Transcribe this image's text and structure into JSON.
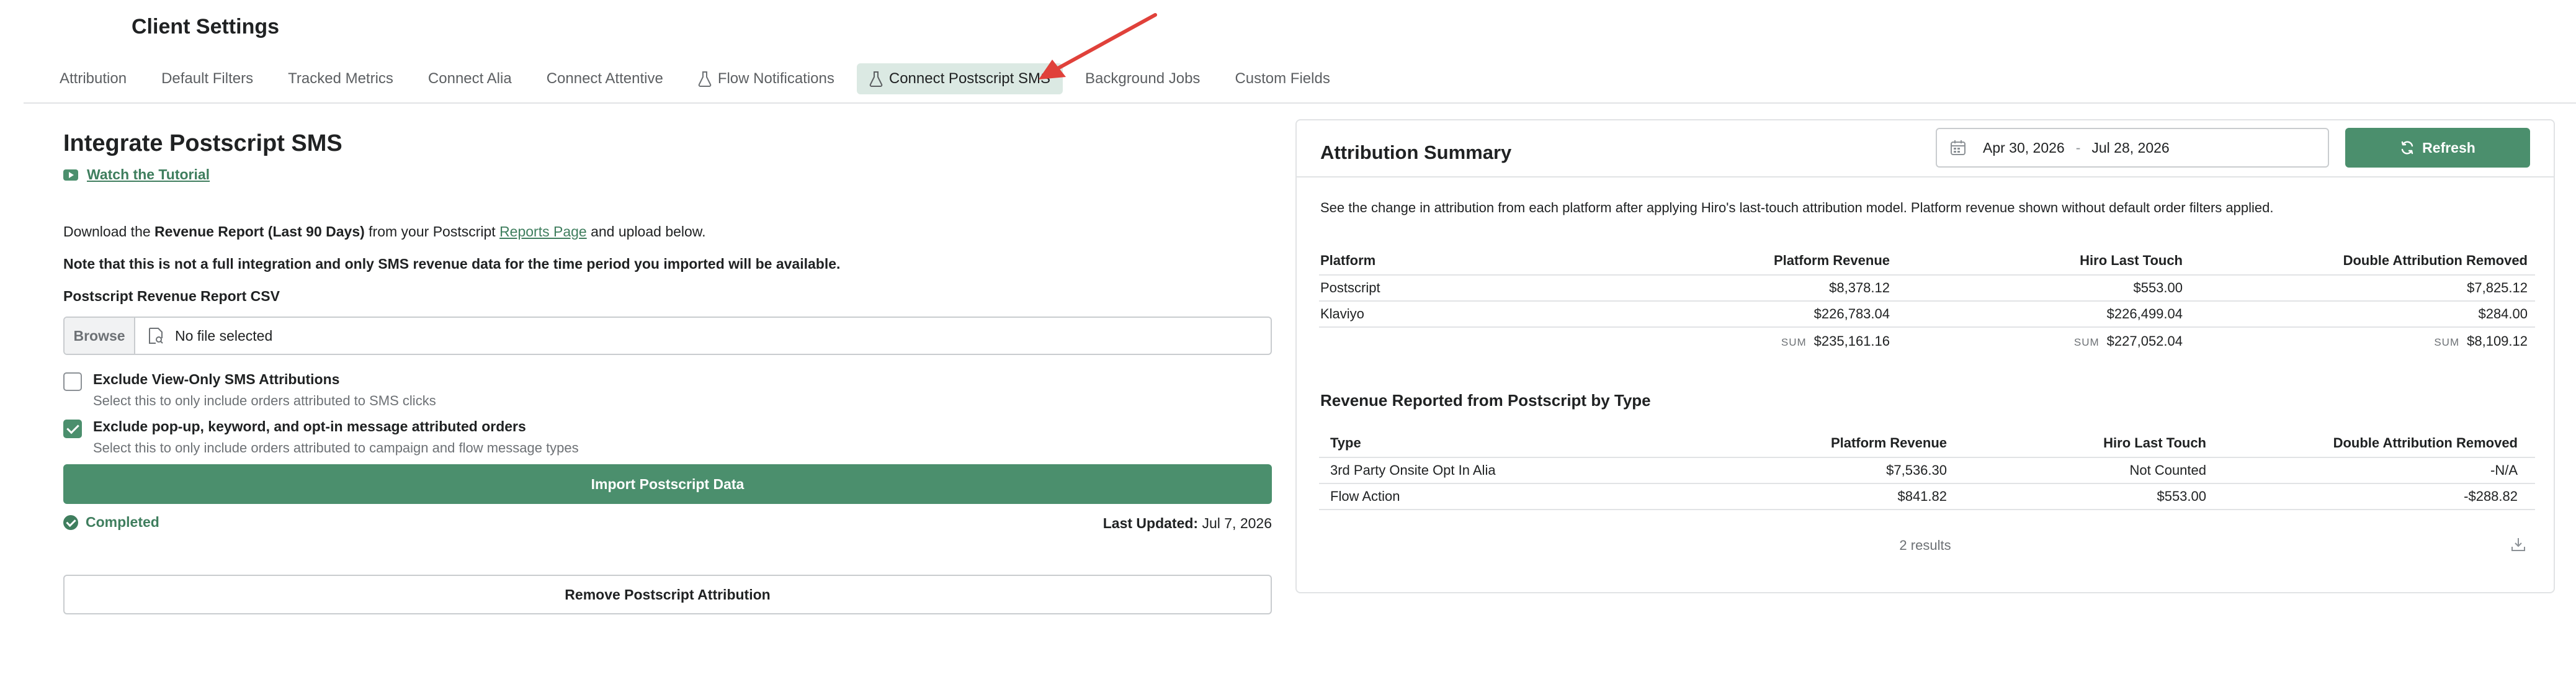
{
  "header": {
    "title": "Client Settings"
  },
  "tabs": [
    {
      "label": "Attribution"
    },
    {
      "label": "Default Filters"
    },
    {
      "label": "Tracked Metrics"
    },
    {
      "label": "Connect Alia"
    },
    {
      "label": "Connect Attentive"
    },
    {
      "label": "Flow Notifications",
      "icon": "flask-icon"
    },
    {
      "label": "Connect Postscript SMS",
      "icon": "flask-icon",
      "active": true
    },
    {
      "label": "Background Jobs"
    },
    {
      "label": "Custom Fields"
    }
  ],
  "integrate": {
    "title": "Integrate Postscript SMS",
    "tutorial_label": "Watch the Tutorial",
    "desc_prefix": "Download the ",
    "desc_report": "Revenue Report (Last 90 Days)",
    "desc_middle": " from your Postscript ",
    "desc_link": "Reports Page",
    "desc_suffix": " and upload below.",
    "note": "Note that this is not a full integration and only SMS revenue data for the time period you imported will be available.",
    "csv_label": "Postscript Revenue Report CSV",
    "browse_label": "Browse",
    "file_status": "No file selected",
    "checkbox1": {
      "title": "Exclude View-Only SMS Attributions",
      "sub": "Select this to only include orders attributed to SMS clicks",
      "checked": false
    },
    "checkbox2": {
      "title": "Exclude pop-up, keyword, and opt-in message attributed orders",
      "sub": "Select this to only include orders attributed to campaign and flow message types",
      "checked": true
    },
    "import_label": "Import Postscript Data",
    "status": "Completed",
    "last_updated_label": "Last Updated:",
    "last_updated_value": "Jul 7, 2026",
    "remove_label": "Remove Postscript Attribution"
  },
  "summary": {
    "title": "Attribution Summary",
    "date_start": "Apr 30, 2026",
    "date_sep": "-",
    "date_end": "Jul 28, 2026",
    "refresh_label": "Refresh",
    "description": "See the change in attribution from each platform after applying Hiro's last-touch attribution model. Platform revenue shown without default order filters applied.",
    "table": {
      "headers": [
        "Platform",
        "Platform Revenue",
        "Hiro Last Touch",
        "Double Attribution Removed"
      ],
      "rows": [
        [
          "Postscript",
          "$8,378.12",
          "$553.00",
          "$7,825.12"
        ],
        [
          "Klaviyo",
          "$226,783.04",
          "$226,499.04",
          "$284.00"
        ]
      ],
      "sum_label": "SUM",
      "sums": [
        "$235,161.16",
        "$227,052.04",
        "$8,109.12"
      ]
    },
    "by_type_title": "Revenue Reported from Postscript by Type",
    "type_table": {
      "headers": [
        "Type",
        "Platform Revenue",
        "Hiro Last Touch",
        "Double Attribution Removed"
      ],
      "rows": [
        [
          "3rd Party Onsite Opt In Alia",
          "$7,536.30",
          "Not Counted",
          "-N/A"
        ],
        [
          "Flow Action",
          "$841.82",
          "$553.00",
          "-$288.82"
        ]
      ]
    },
    "results": "2 results"
  },
  "colors": {
    "accent": "#4b8f6d",
    "accent_text": "#3f7e5e",
    "active_tab_bg": "#dbe9e3",
    "annotation_arrow": "#e0413a"
  }
}
